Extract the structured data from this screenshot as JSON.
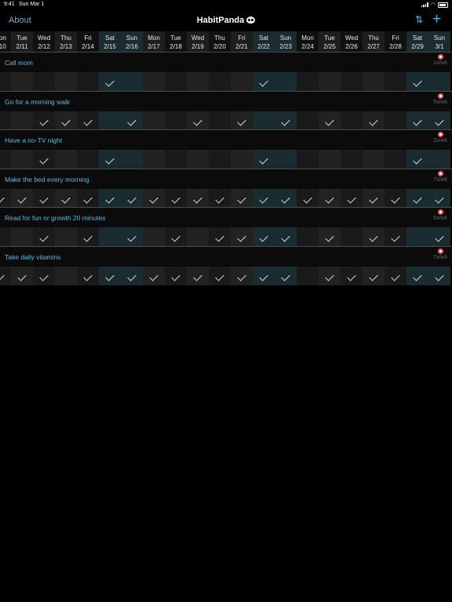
{
  "status_bar": {
    "time": "9:41",
    "date": "Sun Mar 1"
  },
  "nav": {
    "about_label": "About",
    "title": "HabitPanda",
    "sort_icon": "⇅",
    "add_icon": "+"
  },
  "days": [
    {
      "dow": "Mon",
      "date": "2/10",
      "weekend": false
    },
    {
      "dow": "Tue",
      "date": "2/11",
      "weekend": false
    },
    {
      "dow": "Wed",
      "date": "2/12",
      "weekend": false
    },
    {
      "dow": "Thu",
      "date": "2/13",
      "weekend": false
    },
    {
      "dow": "Fri",
      "date": "2/14",
      "weekend": false
    },
    {
      "dow": "Sat",
      "date": "2/15",
      "weekend": true
    },
    {
      "dow": "Sun",
      "date": "2/16",
      "weekend": true
    },
    {
      "dow": "Mon",
      "date": "2/17",
      "weekend": false
    },
    {
      "dow": "Tue",
      "date": "2/18",
      "weekend": false
    },
    {
      "dow": "Wed",
      "date": "2/19",
      "weekend": false
    },
    {
      "dow": "Thu",
      "date": "2/20",
      "weekend": false
    },
    {
      "dow": "Fri",
      "date": "2/21",
      "weekend": false
    },
    {
      "dow": "Sat",
      "date": "2/22",
      "weekend": true
    },
    {
      "dow": "Sun",
      "date": "2/23",
      "weekend": true
    },
    {
      "dow": "Mon",
      "date": "2/24",
      "weekend": false
    },
    {
      "dow": "Tue",
      "date": "2/25",
      "weekend": false
    },
    {
      "dow": "Wed",
      "date": "2/26",
      "weekend": false
    },
    {
      "dow": "Thu",
      "date": "2/27",
      "weekend": false
    },
    {
      "dow": "Fri",
      "date": "2/28",
      "weekend": false
    },
    {
      "dow": "Sat",
      "date": "2/29",
      "weekend": true
    },
    {
      "dow": "Sun",
      "date": "3/1",
      "weekend": true
    }
  ],
  "habits": [
    {
      "name": "Call mom",
      "goal": "1x/wk",
      "checks": [
        0,
        0,
        0,
        0,
        0,
        1,
        0,
        0,
        0,
        0,
        0,
        0,
        1,
        0,
        0,
        0,
        0,
        0,
        0,
        1,
        0
      ]
    },
    {
      "name": "Go for a morning walk",
      "goal": "5x/wk",
      "checks": [
        0,
        0,
        1,
        1,
        1,
        0,
        1,
        0,
        0,
        1,
        0,
        1,
        0,
        1,
        0,
        1,
        0,
        1,
        0,
        1,
        1
      ]
    },
    {
      "name": "Have a no-TV night",
      "goal": "2x/wk",
      "checks": [
        0,
        0,
        1,
        0,
        0,
        1,
        0,
        0,
        0,
        0,
        0,
        0,
        1,
        0,
        0,
        0,
        0,
        0,
        0,
        1,
        0
      ]
    },
    {
      "name": "Make the bed every morning",
      "goal": "7x/wk",
      "checks": [
        1,
        1,
        1,
        1,
        1,
        1,
        1,
        1,
        1,
        1,
        1,
        1,
        1,
        1,
        1,
        1,
        1,
        1,
        1,
        1,
        1
      ]
    },
    {
      "name": "Read for fun or growth 20 minutes",
      "goal": "5x/wk",
      "checks": [
        0,
        0,
        1,
        0,
        1,
        0,
        1,
        0,
        1,
        0,
        1,
        1,
        1,
        1,
        0,
        1,
        0,
        1,
        1,
        0,
        1
      ]
    },
    {
      "name": "Take daily vitamins",
      "goal": "7x/wk",
      "checks": [
        1,
        1,
        1,
        0,
        1,
        1,
        1,
        1,
        1,
        1,
        1,
        1,
        1,
        1,
        0,
        1,
        1,
        1,
        1,
        1,
        1
      ]
    }
  ]
}
